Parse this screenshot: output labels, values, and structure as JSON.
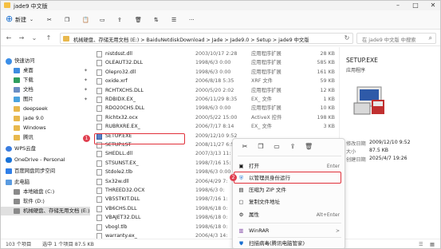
{
  "window": {
    "title": "jade9 中文版"
  },
  "toolbar": {
    "new_label": "新建"
  },
  "address": {
    "path": "机械硬盘、存储无用文档 (E:)  >  BaiduNetdiskDownload  >  Jade  >  Jade9.0  >  Setup  >  jade9 中文版",
    "search_placeholder": "在 jade9 中文版 中搜索"
  },
  "sidebar": {
    "items": [
      {
        "label": "快速访问"
      },
      {
        "label": "桌面"
      },
      {
        "label": "下载"
      },
      {
        "label": "文档"
      },
      {
        "label": "图片"
      },
      {
        "label": "deepseek"
      },
      {
        "label": "jade 9.0"
      },
      {
        "label": "Windows"
      },
      {
        "label": "腾讯"
      },
      {
        "label": "WPS云盘"
      },
      {
        "label": "OneDrive - Personal"
      },
      {
        "label": "百度网盘同步空间"
      },
      {
        "label": "此电脑"
      },
      {
        "label": "本地磁盘 (C:)"
      },
      {
        "label": "软件 (D:)"
      },
      {
        "label": "机械硬盘、存储无用文档 (E:)"
      }
    ]
  },
  "files": [
    {
      "name": "nistdsst.dll",
      "date": "2003/10/17 2:28",
      "type": "应用程序扩展",
      "size": "28 KB"
    },
    {
      "name": "OLEAUT32.DLL",
      "date": "1998/6/3 0:00",
      "type": "应用程序扩展",
      "size": "585 KB"
    },
    {
      "name": "Olepro32.dll",
      "date": "1998/6/3 0:00",
      "type": "应用程序扩展",
      "size": "161 KB"
    },
    {
      "name": "oxide.xrf",
      "date": "2006/8/18 5:35",
      "type": "XRF 文件",
      "size": "59 KB"
    },
    {
      "name": "RCHTXCHS.DLL",
      "date": "2000/5/20 2:02",
      "type": "应用程序扩展",
      "size": "12 KB"
    },
    {
      "name": "RDBIDX.EX_",
      "date": "2006/11/29 8:35",
      "type": "EX_ 文件",
      "size": "1 KB"
    },
    {
      "name": "RDO20CHS.DLL",
      "date": "1998/6/3 0:00",
      "type": "应用程序扩展",
      "size": "10 KB"
    },
    {
      "name": "Richtx32.ocx",
      "date": "2000/5/22 15:00",
      "type": "ActiveX 控件",
      "size": "198 KB"
    },
    {
      "name": "RUBRXRE.EX_",
      "date": "2006/7/17 8:14",
      "type": "EX_ 文件",
      "size": "3 KB"
    },
    {
      "name": "SETUP.EXE",
      "date": "2009/12/10 9:52",
      "type": "",
      "size": ""
    },
    {
      "name": "SETUP.LST",
      "date": "2008/11/27 6:5",
      "type": "",
      "size": ""
    },
    {
      "name": "SHEDLL.dll",
      "date": "2007/3/13 11:",
      "type": "",
      "size": ""
    },
    {
      "name": "STSUNST.EX_",
      "date": "1998/7/16 15:",
      "type": "",
      "size": ""
    },
    {
      "name": "Stdole2.tlb",
      "date": "1998/6/3 0:00",
      "type": "",
      "size": ""
    },
    {
      "name": "Sx32w.dll",
      "date": "2006/4/29 7:",
      "type": "",
      "size": ""
    },
    {
      "name": "THREED32.OCX",
      "date": "1998/6/3 0:",
      "type": "",
      "size": ""
    },
    {
      "name": "VB5STKIT.DLL",
      "date": "1998/7/16 1:",
      "type": "",
      "size": ""
    },
    {
      "name": "VB6CHS.DLL",
      "date": "1998/6/18 0:",
      "type": "",
      "size": ""
    },
    {
      "name": "VBAJET32.DLL",
      "date": "1998/6/18 0:",
      "type": "",
      "size": ""
    },
    {
      "name": "vbogl.tlb",
      "date": "1998/6/18 0:",
      "type": "",
      "size": ""
    },
    {
      "name": "warranty.ex_",
      "date": "2006/4/3 14:",
      "type": "",
      "size": ""
    }
  ],
  "details": {
    "name": "SETUP.EXE",
    "type": "应用程序",
    "rows": [
      {
        "label": "修改日期",
        "value": "2009/12/10 9:52"
      },
      {
        "label": "大小",
        "value": "87.5 KB"
      },
      {
        "label": "创建日期",
        "value": "2025/4/7 19:26"
      }
    ]
  },
  "context_menu": {
    "items": [
      {
        "icon": "open-icon",
        "label": "打开",
        "shortcut": "Enter"
      },
      {
        "icon": "run-as-admin-icon",
        "label": "以管理员身份运行",
        "shortcut": ""
      },
      {
        "icon": "zip-icon",
        "label": "压缩为 ZIP 文件",
        "shortcut": ""
      },
      {
        "icon": "copy-path-icon",
        "label": "复制文件地址",
        "shortcut": ""
      },
      {
        "icon": "properties-icon",
        "label": "属性",
        "shortcut": "Alt+Enter"
      },
      {
        "icon": "winrar-icon",
        "label": "WinRAR",
        "shortcut": ">"
      },
      {
        "icon": "virus-scan-icon",
        "label": "扫描病毒(腾讯电脑管家)",
        "shortcut": ""
      }
    ]
  },
  "badges": {
    "step1": "1",
    "step2": "2"
  },
  "status": {
    "count": "103 个项目",
    "selected": "选中 1 个项目  87.5 KB"
  },
  "colors": {
    "highlight": "#e0303a",
    "badge": "#e04050",
    "accent": "#1a6fd0"
  }
}
